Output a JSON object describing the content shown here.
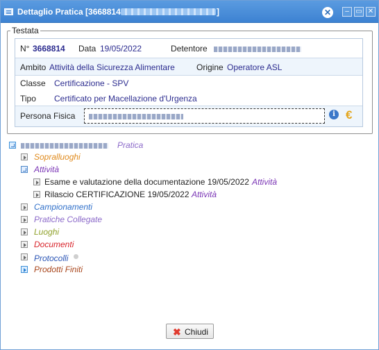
{
  "window": {
    "title": "Dettaglio Pratica [3668814 -",
    "title_close_bracket": "]"
  },
  "testata": {
    "legend": "Testata",
    "numero_label": "N°",
    "numero_value": "3668814",
    "data_label": "Data",
    "data_value": "19/05/2022",
    "detentore_label": "Detentore",
    "ambito_label": "Ambito",
    "ambito_value": "Attività della Sicurezza Alimentare",
    "origine_label": "Origine",
    "origine_value": "Operatore ASL",
    "classe_label": "Classe",
    "classe_value": "Certificazione - SPV",
    "tipo_label": "Tipo",
    "tipo_value": "Certificato per Macellazione d'Urgenza",
    "persona_label": "Persona Fisica"
  },
  "tree": {
    "root_suffix": "Pratica",
    "items": {
      "sopralluoghi": "Sopralluoghi",
      "attivita": "Attività",
      "attivita_child_1_text": "Esame e valutazione della documentazione 19/05/2022",
      "attivita_child_1_tag": "Attività",
      "attivita_child_2_text": "Rilascio CERTIFICAZIONE 19/05/2022",
      "attivita_child_2_tag": "Attività",
      "campionamenti": "Campionamenti",
      "pratiche_collegate": "Pratiche Collegate",
      "luoghi": "Luoghi",
      "documenti": "Documenti",
      "protocolli": "Protocolli",
      "prodotti_finiti": "Prodotti Finiti"
    }
  },
  "footer": {
    "close_label": "Chiudi"
  },
  "colors": {
    "titlebar": "#3d82d2",
    "accent_value": "#2c2c8f",
    "sopralluoghi": "#e08a1c",
    "attivita": "#7a34b5",
    "campionamenti": "#2f6fc9",
    "pratiche_collegate": "#8b69c9",
    "luoghi": "#8fa12a",
    "documenti": "#d8232a",
    "protocolli": "#2b55b5",
    "prodotti_finiti": "#a8451b"
  }
}
